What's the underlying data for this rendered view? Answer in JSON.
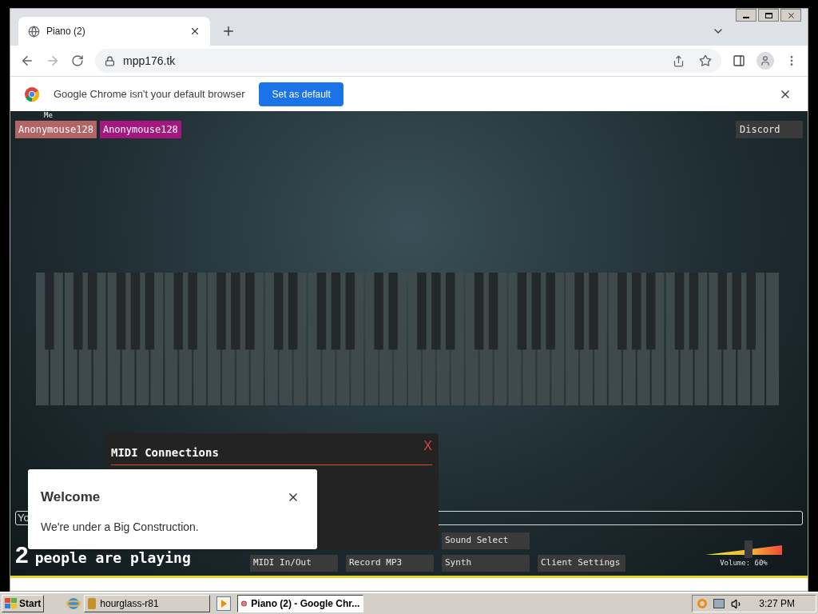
{
  "tabs": [
    {
      "title": "Piano (2)",
      "selected": true
    }
  ],
  "address": "mpp176.tk",
  "infobar": {
    "message": "Google Chrome isn't your default browser",
    "button": "Set as default"
  },
  "page": {
    "users": [
      {
        "name": "Anonymouse128",
        "tag": "Me",
        "color": "#b36565"
      },
      {
        "name": "Anonymouse128",
        "color": "#a3177f"
      }
    ],
    "discord": "Discord",
    "midi_dialog": {
      "title": "MIDI Connections",
      "close": "X"
    },
    "welcome": {
      "title": "Welcome",
      "message": "We're under a Big Construction."
    },
    "chat": {
      "placeholder": "Yo"
    },
    "player_count": "2",
    "player_label": "people are playing",
    "top_buttons": [
      "Sound Select"
    ],
    "bottom_buttons": [
      "MIDI In/Out",
      "Record MP3",
      "Synth",
      "Client Settings"
    ],
    "volume": {
      "level": 0.56,
      "label": "Volume: 60%"
    }
  },
  "taskbar": {
    "start": "Start",
    "tasks": [
      {
        "label": "hourglass-r81",
        "selected": false
      },
      {
        "label": "Piano (2) - Google Chr...",
        "selected": true
      }
    ],
    "clock": "3:27 PM"
  }
}
